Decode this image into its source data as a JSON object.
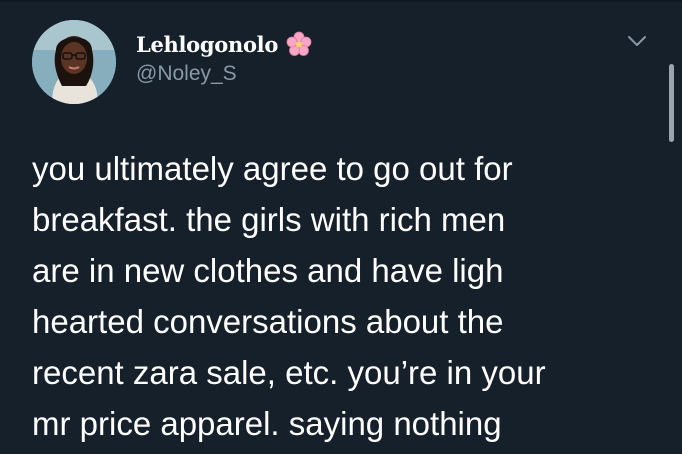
{
  "tweet": {
    "author": {
      "display_name": "Lehlogonolo",
      "handle": "@Noley_S",
      "name_emoji_icon": "cherry-blossom-icon",
      "avatar": "profile-photo"
    },
    "menu_icon": "chevron-down-icon",
    "body_lines": [
      "you ultimately agree to go out for",
      "breakfast. the girls with rich men",
      "are in new clothes and have ligh",
      "hearted conversations about the",
      "recent zara sale, etc. you’re in your",
      "mr price apparel. saying nothing"
    ]
  },
  "colors": {
    "background": "#15202b",
    "text_primary": "#ffffff",
    "text_secondary": "#8899a6",
    "flower_pink": "#f6a7c3"
  }
}
